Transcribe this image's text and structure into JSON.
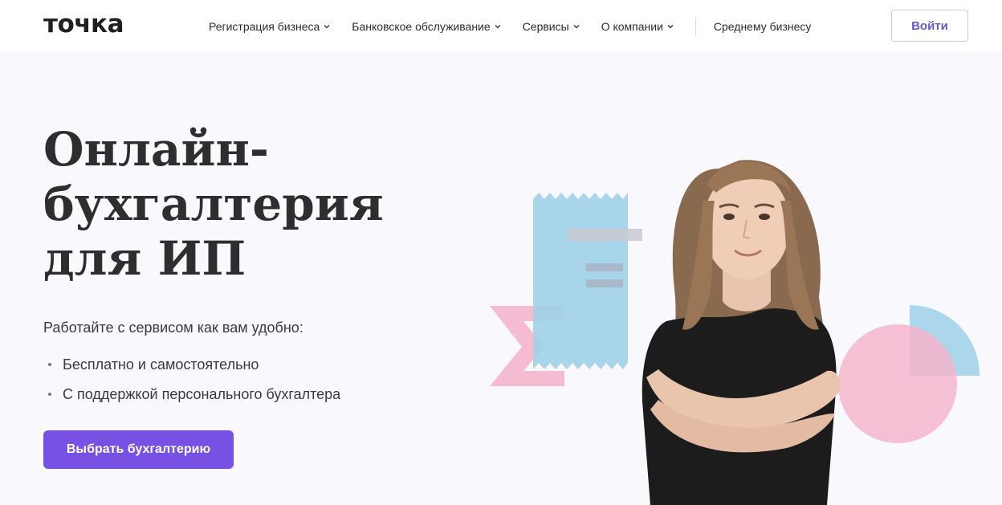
{
  "header": {
    "logo": "точка",
    "nav": [
      {
        "label": "Регистрация бизнеса",
        "has_dropdown": true
      },
      {
        "label": "Банковское обслуживание",
        "has_dropdown": true
      },
      {
        "label": "Сервисы",
        "has_dropdown": true
      },
      {
        "label": "О компании",
        "has_dropdown": true
      }
    ],
    "nav_extra": "Среднему бизнесу",
    "login_label": "Войти"
  },
  "hero": {
    "title_lines": [
      "Онлайн-",
      "бухгалтерия",
      "для ИП"
    ],
    "subtitle": "Работайте с сервисом как вам удобно:",
    "bullets": [
      "Бесплатно и самостоятельно",
      "С поддержкой персонального бухгалтера"
    ],
    "cta_label": "Выбрать бухгалтерию"
  },
  "colors": {
    "accent": "#7651e3",
    "login_text": "#6a55c9",
    "shape_blue": "#9fd0e8",
    "shape_pink": "#f4b5cc",
    "shape_gray": "#c9c9cf"
  },
  "icons": {
    "nav_dropdown": "chevron-down-icon",
    "sigma_shape": "sigma-shape",
    "receipt_shape": "receipt-shape",
    "circle_shape": "circle-shape",
    "quarter_circle_shape": "quarter-circle-shape"
  }
}
